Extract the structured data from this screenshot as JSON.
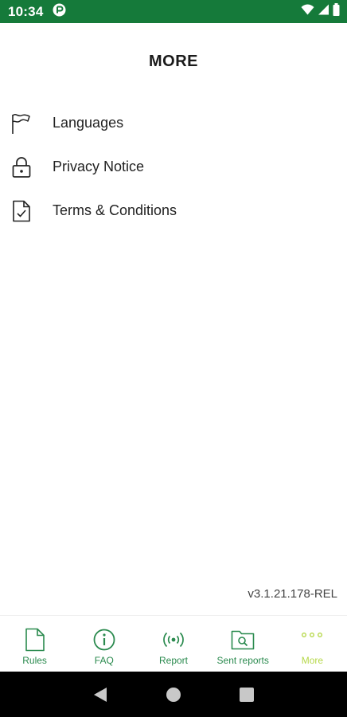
{
  "status_bar": {
    "time": "10:34",
    "background_color": "#157a3a",
    "icons": [
      "app-notification-icon",
      "wifi-icon",
      "cellular-signal-icon",
      "battery-icon"
    ]
  },
  "header": {
    "title": "MORE"
  },
  "menu": {
    "items": [
      {
        "label": "Languages",
        "icon": "flag-icon"
      },
      {
        "label": "Privacy Notice",
        "icon": "lock-icon"
      },
      {
        "label": "Terms & Conditions",
        "icon": "document-check-icon"
      }
    ]
  },
  "version": "v3.1.21.178-REL",
  "bottom_nav": {
    "accent_color": "#2a8a4e",
    "active_color": "#b6d84a",
    "items": [
      {
        "label": "Rules",
        "icon": "document-icon",
        "active": false
      },
      {
        "label": "FAQ",
        "icon": "info-icon",
        "active": false
      },
      {
        "label": "Report",
        "icon": "broadcast-icon",
        "active": false
      },
      {
        "label": "Sent reports",
        "icon": "folder-search-icon",
        "active": false
      },
      {
        "label": "More",
        "icon": "more-dots-icon",
        "active": true
      }
    ]
  },
  "system_nav": {
    "buttons": [
      "back-icon",
      "home-icon",
      "recents-icon"
    ]
  }
}
